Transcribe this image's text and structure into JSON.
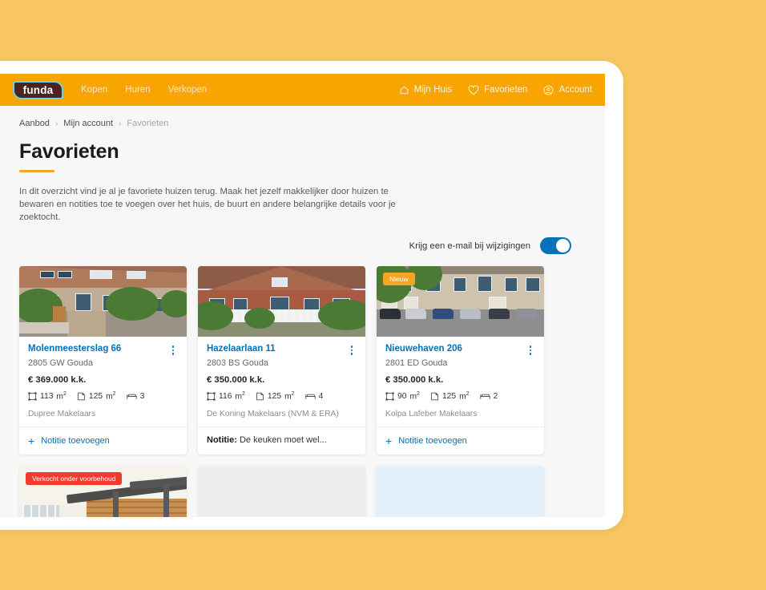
{
  "theme": {
    "page_bg": "#f7c662",
    "nav_orange": "#f9a501",
    "link_blue": "#0471b8",
    "accent_yellow": "#f4a620",
    "sold_red": "#f03c2e"
  },
  "navbar": {
    "logo_text": "funda",
    "links": [
      {
        "label": "Kopen"
      },
      {
        "label": "Huren"
      },
      {
        "label": "Verkopen"
      }
    ],
    "account_links": [
      {
        "label": "Mijn Huis",
        "icon": "house-icon"
      },
      {
        "label": "Favorieten",
        "icon": "heart-icon"
      },
      {
        "label": "Account",
        "icon": "user-circle-icon"
      }
    ]
  },
  "breadcrumb": {
    "items": [
      {
        "label": "Aanbod",
        "current": false
      },
      {
        "label": "Mijn account",
        "current": false
      },
      {
        "label": "Favorieten",
        "current": true
      }
    ],
    "separator": "›"
  },
  "page": {
    "title": "Favorieten",
    "intro": "In dit overzicht vind je al je favoriete huizen terug. Maak het jezelf makkelijker door huizen te bewaren en notities toe te voegen over het huis, de buurt en andere belangrijke details voor je zoektocht."
  },
  "email_toggle": {
    "label": "Krijg een e-mail bij wijzigingen",
    "state": "on"
  },
  "units": {
    "area": "m",
    "area_sup": "2"
  },
  "cards": [
    {
      "address": "Molenmeesterslag 66",
      "postcode": "2805 GW Gouda",
      "price": "€ 369.000 k.k.",
      "plot": "113",
      "living": "125",
      "bedrooms": "3",
      "agent": "Dupree Makelaars",
      "footer_type": "add_note",
      "footer_label": "Notitie toevoegen",
      "badge": null,
      "menu_icon": "kebab-menu-icon"
    },
    {
      "address": "Hazelaarlaan 11",
      "postcode": "2803 BS Gouda",
      "price": "€ 350.000 k.k.",
      "plot": "116",
      "living": "125",
      "bedrooms": "4",
      "agent": "De Koning Makelaars (NVM & ERA)",
      "footer_type": "note",
      "footer_note_label": "Notitie:",
      "footer_note_text": "De keuken moet wel...",
      "badge": null,
      "menu_icon": "kebab-menu-icon"
    },
    {
      "address": "Nieuwehaven 206",
      "postcode": "2801 ED Gouda",
      "price": "€ 350.000 k.k.",
      "plot": "90",
      "living": "125",
      "bedrooms": "2",
      "agent": "Kolpa Lafeber Makelaars",
      "footer_type": "add_note",
      "footer_label": "Notitie toevoegen",
      "badge": {
        "text": "Nieuw",
        "style": "nieuw"
      },
      "menu_icon": "kebab-menu-icon"
    }
  ],
  "cards_row2": [
    {
      "badge": {
        "text": "Verkocht onder voorbehoud",
        "style": "sold"
      },
      "thumb": "interior-photo"
    },
    {
      "badge": null,
      "thumb": "gray-placeholder"
    },
    {
      "badge": null,
      "thumb": "blue-placeholder"
    }
  ]
}
